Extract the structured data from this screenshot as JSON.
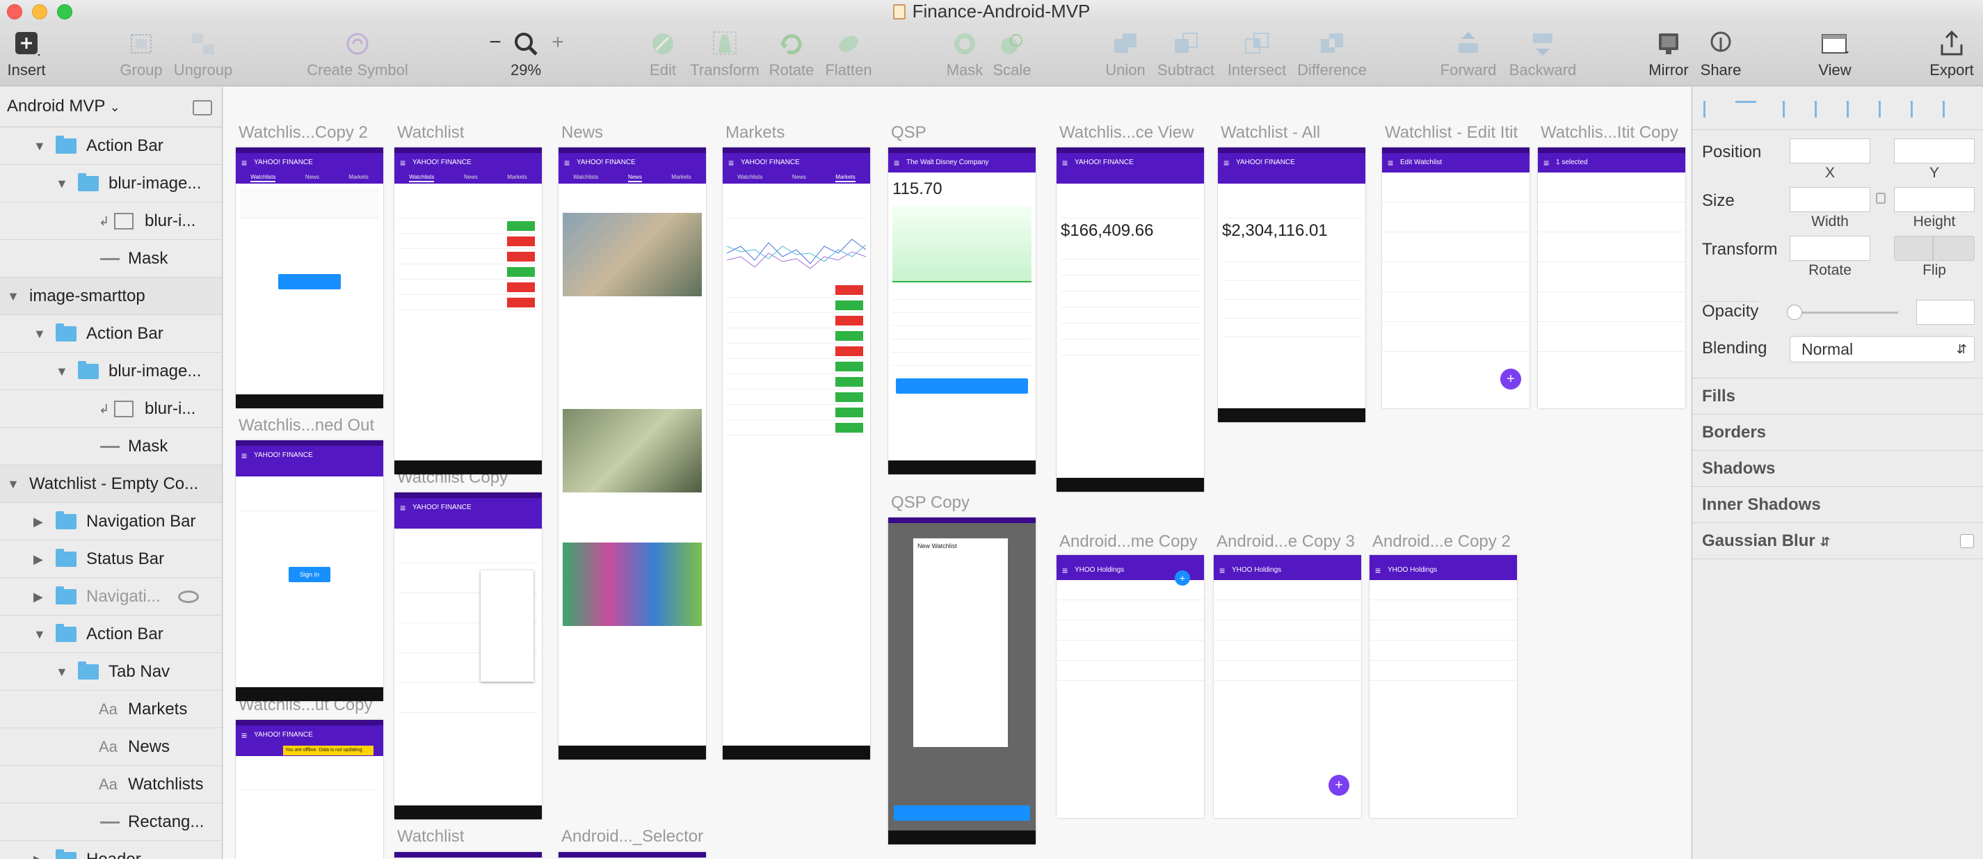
{
  "window": {
    "title": "Finance-Android-MVP"
  },
  "toolbar": {
    "insert": "Insert",
    "group": "Group",
    "ungroup": "Ungroup",
    "create_symbol": "Create Symbol",
    "zoom_minus": "−",
    "zoom_plus": "+",
    "zoom_level": "29%",
    "edit": "Edit",
    "transform": "Transform",
    "rotate": "Rotate",
    "flatten": "Flatten",
    "mask": "Mask",
    "scale": "Scale",
    "union": "Union",
    "subtract": "Subtract",
    "intersect": "Intersect",
    "difference": "Difference",
    "forward": "Forward",
    "backward": "Backward",
    "mirror": "Mirror",
    "share": "Share",
    "view": "View",
    "export": "Export"
  },
  "sidebar": {
    "page": "Android MVP",
    "layers": [
      {
        "label": "Action Bar",
        "kind": "group",
        "level": 1,
        "open": true
      },
      {
        "label": "blur-image...",
        "kind": "group",
        "level": 2,
        "open": true
      },
      {
        "label": "blur-i...",
        "kind": "image",
        "level": 3
      },
      {
        "label": "Mask",
        "kind": "mask",
        "level": 3
      },
      {
        "label": "image-smarttop",
        "kind": "group",
        "level": 0,
        "open": true
      },
      {
        "label": "Action Bar",
        "kind": "group",
        "level": 1,
        "open": true
      },
      {
        "label": "blur-image...",
        "kind": "group",
        "level": 2,
        "open": true
      },
      {
        "label": "blur-i...",
        "kind": "image",
        "level": 3
      },
      {
        "label": "Mask",
        "kind": "mask",
        "level": 3
      },
      {
        "label": "Watchlist - Empty Co...",
        "kind": "group",
        "level": 0,
        "open": true
      },
      {
        "label": "Navigation Bar",
        "kind": "group",
        "level": 1,
        "open": false
      },
      {
        "label": "Status Bar",
        "kind": "group",
        "level": 1,
        "open": false
      },
      {
        "label": "Navigati...",
        "kind": "group",
        "level": 1,
        "open": false,
        "hidden": true
      },
      {
        "label": "Action Bar",
        "kind": "group",
        "level": 1,
        "open": true
      },
      {
        "label": "Tab Nav",
        "kind": "group",
        "level": 2,
        "open": true
      },
      {
        "label": "Markets",
        "kind": "text",
        "level": 3
      },
      {
        "label": "News",
        "kind": "text",
        "level": 3
      },
      {
        "label": "Watchlists",
        "kind": "text",
        "level": 3
      },
      {
        "label": "Rectang...",
        "kind": "rect",
        "level": 3
      },
      {
        "label": "Header",
        "kind": "group",
        "level": 1,
        "open": false
      }
    ]
  },
  "canvas": {
    "artboards": [
      {
        "label": "Watchlis...Copy 2",
        "title": "YAHOO! FINANCE",
        "tabs": [
          "Watchlists",
          "News",
          "Markets"
        ]
      },
      {
        "label": "Watchlist",
        "title": "YAHOO! FINANCE",
        "tabs": [
          "Watchlists",
          "News",
          "Markets"
        ]
      },
      {
        "label": "News",
        "title": "YAHOO! FINANCE",
        "tabs": [
          "Watchlists",
          "News",
          "Markets"
        ]
      },
      {
        "label": "Markets",
        "title": "YAHOO! FINANCE",
        "tabs": [
          "Watchlists",
          "News",
          "Markets"
        ]
      },
      {
        "label": "QSP",
        "title": "The Walt Disney Company",
        "price": "115.70"
      },
      {
        "label": "Watchlis...ce View",
        "title": "YAHOO! FINANCE",
        "big": "$166,409.66"
      },
      {
        "label": "Watchlist - All",
        "title": "YAHOO! FINANCE",
        "big": "$2,304,116.01"
      },
      {
        "label": "Watchlist - Edit Itit",
        "title": "Edit Watchlist"
      },
      {
        "label": "Watchlis...Itit Copy",
        "title": "1 selected"
      },
      {
        "label": "Watchlis...ned Out",
        "title": "YAHOO! FINANCE",
        "button": "Sign In"
      },
      {
        "label": "Watchlist Copy",
        "title": "YAHOO! FINANCE"
      },
      {
        "label": "QSP Copy",
        "title": "New Watchlist"
      },
      {
        "label": "Android...me Copy",
        "title": "YHOO Holdings"
      },
      {
        "label": "Android...e Copy 3",
        "title": "YHOO Holdings"
      },
      {
        "label": "Android...e Copy 2",
        "title": "YHOO Holdings"
      },
      {
        "label": "Watchlis...ut Copy",
        "title": "YAHOO! FINANCE",
        "banner": "You are offline. Data is not updating."
      },
      {
        "label": "Watchlist"
      },
      {
        "label": "Android..._Selector"
      }
    ]
  },
  "inspector": {
    "position": "Position",
    "size": "Size",
    "transform": "Transform",
    "x": "X",
    "y": "Y",
    "width": "Width",
    "height": "Height",
    "rotate": "Rotate",
    "flip": "Flip",
    "opacity": "Opacity",
    "blending": "Blending",
    "blend_mode": "Normal",
    "sections": [
      "Fills",
      "Borders",
      "Shadows",
      "Inner Shadows",
      "Gaussian Blur"
    ]
  },
  "colors": {
    "accent": "#5318c2",
    "negative": "#e5322d",
    "positive": "#2fb344",
    "link": "#188fff"
  }
}
